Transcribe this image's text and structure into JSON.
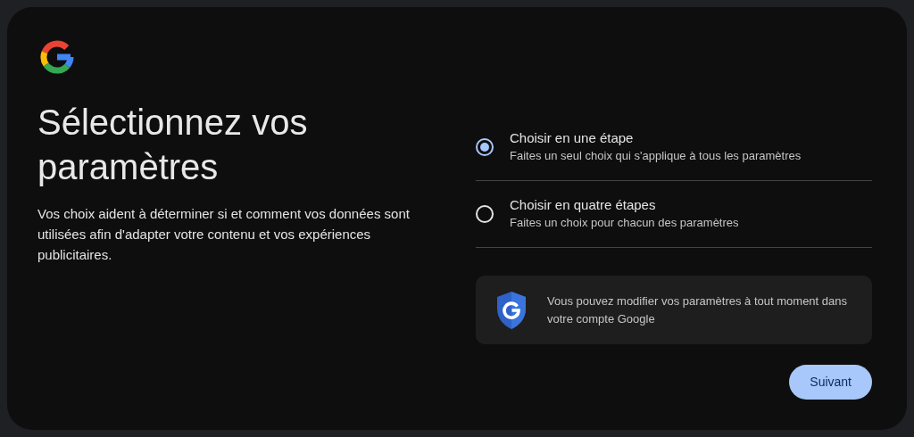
{
  "title": "Sélectionnez vos paramètres",
  "description": "Vos choix aident à déterminer si et comment vos données sont utilisées afin d'adapter votre contenu et vos expériences publicitaires.",
  "options": [
    {
      "label": "Choisir en une étape",
      "detail": "Faites un seul choix qui s'applique à tous les paramètres",
      "selected": true
    },
    {
      "label": "Choisir en quatre étapes",
      "detail": "Faites un choix pour chacun des paramètres",
      "selected": false
    }
  ],
  "notice": "Vous pouvez modifier vos paramètres à tout moment dans votre compte Google",
  "next_button": "Suivant"
}
